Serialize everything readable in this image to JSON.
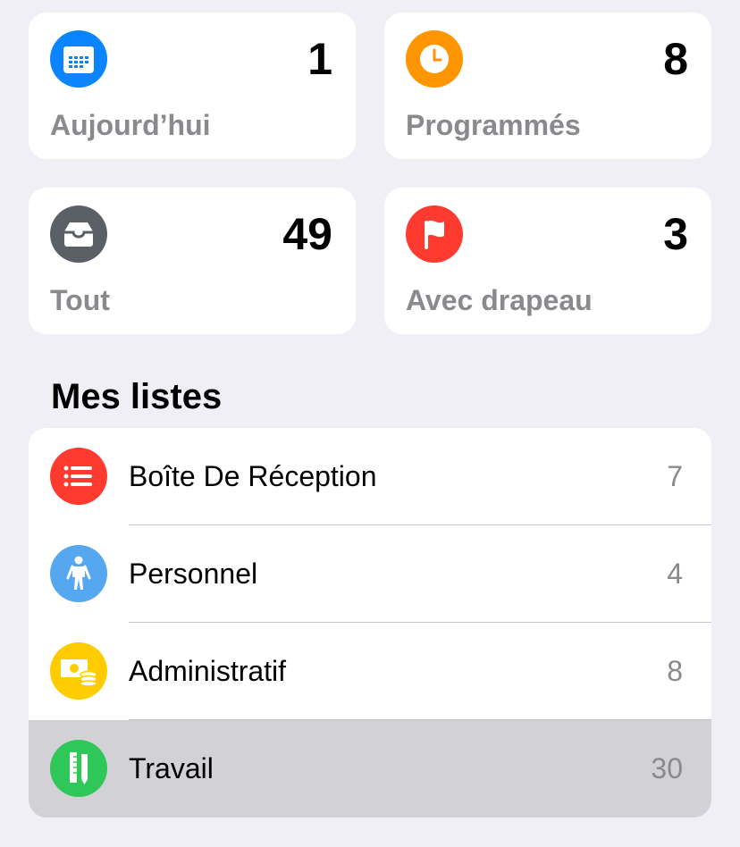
{
  "smart_lists": [
    {
      "label": "Aujourd’hui",
      "count": "1",
      "color": "#0a84ff",
      "icon": "calendar-icon"
    },
    {
      "label": "Programmés",
      "count": "8",
      "color": "#ff9500",
      "icon": "clock-icon"
    },
    {
      "label": "Tout",
      "count": "49",
      "color": "#5b6066",
      "icon": "tray-icon"
    },
    {
      "label": "Avec drapeau",
      "count": "3",
      "color": "#ff3b30",
      "icon": "flag-icon"
    }
  ],
  "my_lists": {
    "title": "Mes listes",
    "items": [
      {
        "label": "Boîte De Réception",
        "count": "7",
        "color": "#ff3b30",
        "icon": "list-bullet-icon"
      },
      {
        "label": "Personnel",
        "count": "4",
        "color": "#55a8f0",
        "icon": "person-icon"
      },
      {
        "label": "Administratif",
        "count": "8",
        "color": "#ffcc00",
        "icon": "money-icon"
      },
      {
        "label": "Travail",
        "count": "30",
        "color": "#30c759",
        "icon": "ruler-pencil-icon",
        "selected": true
      }
    ]
  }
}
